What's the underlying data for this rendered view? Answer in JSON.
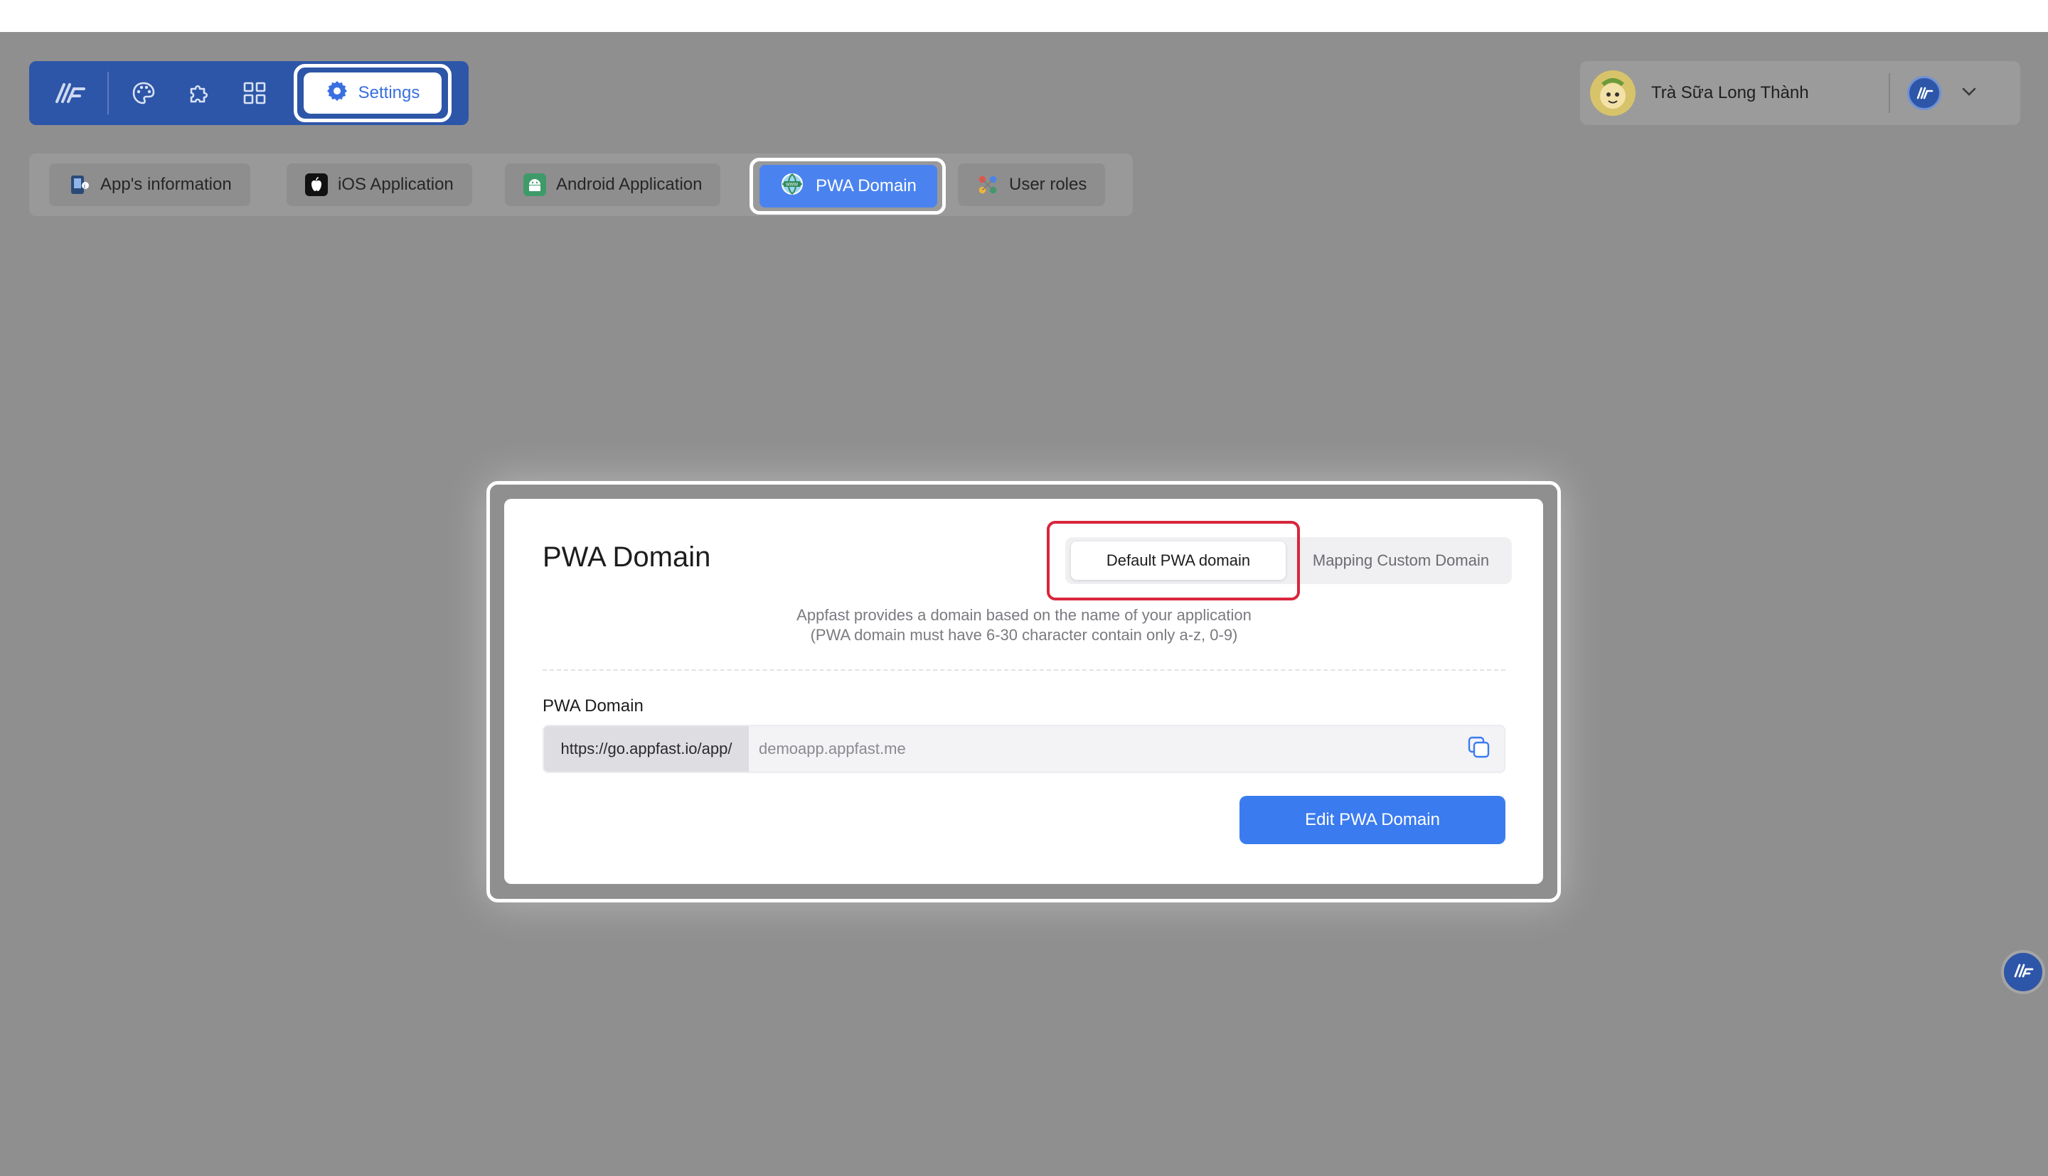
{
  "toolbar": {
    "logo_icon": "appfast-logo-icon",
    "icons": [
      "palette-icon",
      "puzzle-icon",
      "grid-icon"
    ],
    "settings_label": "Settings"
  },
  "user": {
    "name": "Trà Sữa Long Thành",
    "avatar_icon": "avatar-image",
    "app_icon": "appfast-logo-icon"
  },
  "tabs": [
    {
      "label": "App's information",
      "icon": "info-icon"
    },
    {
      "label": "iOS Application",
      "icon": "apple-icon"
    },
    {
      "label": "Android Application",
      "icon": "android-icon"
    },
    {
      "label": "PWA Domain",
      "icon": "globe-icon",
      "active": true
    },
    {
      "label": "User roles",
      "icon": "users-icon"
    }
  ],
  "modal": {
    "title": "PWA Domain",
    "segments": {
      "default": "Default PWA domain",
      "mapping": "Mapping Custom Domain",
      "selected": "default"
    },
    "description_line1": "Appfast provides a domain based on the name of your application",
    "description_line2": "(PWA domain must have 6-30 character contain only a-z, 0-9)",
    "field_label": "PWA Domain",
    "prefix": "https://go.appfast.io/app/",
    "domain_value": "demoapp.appfast.me",
    "edit_button": "Edit PWA Domain"
  },
  "colors": {
    "toolbar_bg": "#2d56a8",
    "accent": "#3a7bf0",
    "highlight": "#d8263c",
    "overlay": "#8f8f8f"
  }
}
